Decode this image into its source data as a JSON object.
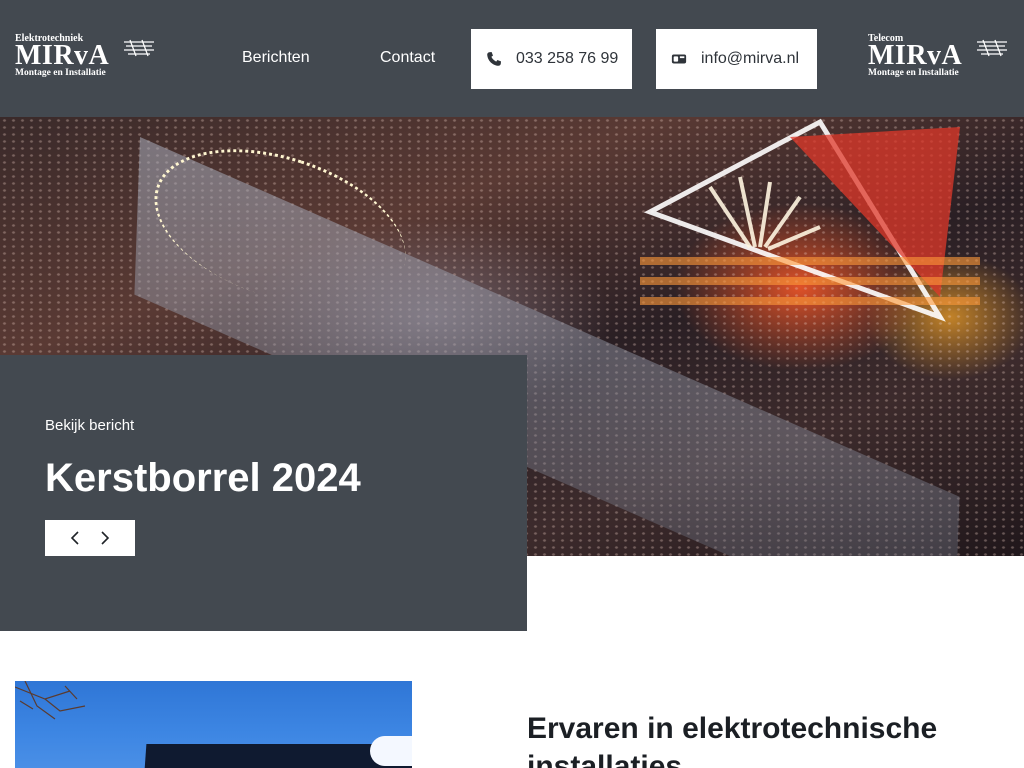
{
  "header": {
    "logo_left": {
      "top": "Elektrotechniek",
      "name": "MIRvA",
      "sub": "Montage en Installatie"
    },
    "logo_right": {
      "top": "Telecom",
      "name": "MIRvA",
      "sub": "Montage en Installatie"
    },
    "nav": [
      {
        "label": "Berichten"
      },
      {
        "label": "Contact"
      }
    ],
    "phone": "033 258 76 99",
    "email": "info@mirva.nl"
  },
  "hero": {
    "kicker": "Bekijk bericht",
    "title": "Kerstborrel 2024"
  },
  "content": {
    "title": "Ervaren in elektrotechnische installaties"
  },
  "colors": {
    "header_bg": "#434950",
    "panel_bg": "#434950",
    "button_bg": "#ffffff"
  },
  "icons": {
    "phone": "phone-icon",
    "mail": "mail-icon",
    "prev": "chevron-left-icon",
    "next": "chevron-right-icon"
  }
}
